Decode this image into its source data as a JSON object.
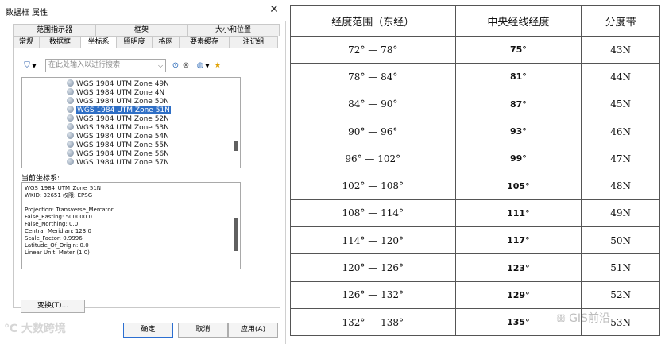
{
  "dialog": {
    "title": "数据框 属性",
    "close_glyph": "✕",
    "tabs_row1": [
      "范围指示器",
      "框架",
      "大小和位置"
    ],
    "tabs_row2": [
      "常规",
      "数据框",
      "坐标系",
      "照明度",
      "格网",
      "要素缓存",
      "注记组"
    ],
    "active_tab": "坐标系",
    "search": {
      "placeholder": "在此处输入以进行搜索"
    },
    "toolbar_icons": [
      "filter-icon",
      "dropdown-icon",
      "search-icon",
      "globe-icon",
      "dropdown-icon",
      "favorite-icon"
    ],
    "crs_items": [
      "WGS 1984 UTM Zone 49N",
      "WGS 1984 UTM Zone 4N",
      "WGS 1984 UTM Zone 50N",
      "WGS 1984 UTM Zone 51N",
      "WGS 1984 UTM Zone 52N",
      "WGS 1984 UTM Zone 53N",
      "WGS 1984 UTM Zone 54N",
      "WGS 1984 UTM Zone 55N",
      "WGS 1984 UTM Zone 56N",
      "WGS 1984 UTM Zone 57N"
    ],
    "selected_crs": "WGS 1984 UTM Zone 51N",
    "current_label": "当前坐标系:",
    "details": [
      "WGS_1984_UTM_Zone_51N",
      "WKID: 32651 权限: EPSG",
      "",
      "Projection: Transverse_Mercator",
      "False_Easting: 500000.0",
      "False_Northing: 0.0",
      "Central_Meridian: 123.0",
      "Scale_Factor: 0.9996",
      "Latitude_Of_Origin: 0.0",
      "Linear Unit: Meter (1.0)"
    ],
    "change_button": "变换(T)...",
    "ok_button": "确定",
    "cancel_button": "取消",
    "apply_button": "应用(A)",
    "selection_color": "#2f6fc6",
    "watermark": "大数跨境"
  },
  "table": {
    "headers": [
      "经度范围（东经）",
      "中央经线经度",
      "分度带"
    ],
    "rows": [
      {
        "range": "72° — 78°",
        "meridian": "75°",
        "zone": "43N"
      },
      {
        "range": "78° — 84°",
        "meridian": "81°",
        "zone": "44N"
      },
      {
        "range": "84° — 90°",
        "meridian": "87°",
        "zone": "45N"
      },
      {
        "range": "90° — 96°",
        "meridian": "93°",
        "zone": "46N"
      },
      {
        "range": "96° — 102°",
        "meridian": "99°",
        "zone": "47N"
      },
      {
        "range": "102° — 108°",
        "meridian": "105°",
        "zone": "48N"
      },
      {
        "range": "108° — 114°",
        "meridian": "111°",
        "zone": "49N"
      },
      {
        "range": "114° — 120°",
        "meridian": "117°",
        "zone": "50N"
      },
      {
        "range": "120° — 126°",
        "meridian": "123°",
        "zone": "51N"
      },
      {
        "range": "126° — 132°",
        "meridian": "129°",
        "zone": "52N"
      },
      {
        "range": "132° — 138°",
        "meridian": "135°",
        "zone": "53N"
      }
    ],
    "watermark": "GIS前沿"
  }
}
